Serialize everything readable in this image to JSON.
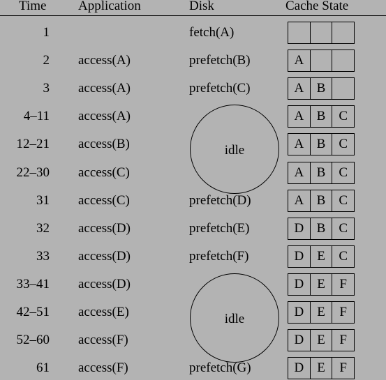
{
  "headers": {
    "time": "Time",
    "application": "Application",
    "disk": "Disk",
    "cache": "Cache State"
  },
  "rows": [
    {
      "time": "1",
      "application": "",
      "disk": "fetch(A)",
      "cache": [
        "",
        "",
        ""
      ]
    },
    {
      "time": "2",
      "application": "access(A)",
      "disk": "prefetch(B)",
      "cache": [
        "A",
        "",
        ""
      ]
    },
    {
      "time": "3",
      "application": "access(A)",
      "disk": "prefetch(C)",
      "cache": [
        "A",
        "B",
        ""
      ]
    },
    {
      "time": "4–11",
      "application": "access(A)",
      "disk": "",
      "cache": [
        "A",
        "B",
        "C"
      ]
    },
    {
      "time": "12–21",
      "application": "access(B)",
      "disk": "",
      "cache": [
        "A",
        "B",
        "C"
      ]
    },
    {
      "time": "22–30",
      "application": "access(C)",
      "disk": "",
      "cache": [
        "A",
        "B",
        "C"
      ]
    },
    {
      "time": "31",
      "application": "access(C)",
      "disk": "prefetch(D)",
      "cache": [
        "A",
        "B",
        "C"
      ]
    },
    {
      "time": "32",
      "application": "access(D)",
      "disk": "prefetch(E)",
      "cache": [
        "D",
        "B",
        "C"
      ]
    },
    {
      "time": "33",
      "application": "access(D)",
      "disk": "prefetch(F)",
      "cache": [
        "D",
        "E",
        "C"
      ]
    },
    {
      "time": "33–41",
      "application": "access(D)",
      "disk": "",
      "cache": [
        "D",
        "E",
        "F"
      ]
    },
    {
      "time": "42–51",
      "application": "access(E)",
      "disk": "",
      "cache": [
        "D",
        "E",
        "F"
      ]
    },
    {
      "time": "52–60",
      "application": "access(F)",
      "disk": "",
      "cache": [
        "D",
        "E",
        "F"
      ]
    },
    {
      "time": "61",
      "application": "access(F)",
      "disk": "prefetch(G)",
      "cache": [
        "D",
        "E",
        "F"
      ]
    }
  ],
  "idle_periods": [
    {
      "label": "idle",
      "rows": "4–11 to 22–30"
    },
    {
      "label": "idle",
      "rows": "33–41 to 52–60"
    }
  ]
}
